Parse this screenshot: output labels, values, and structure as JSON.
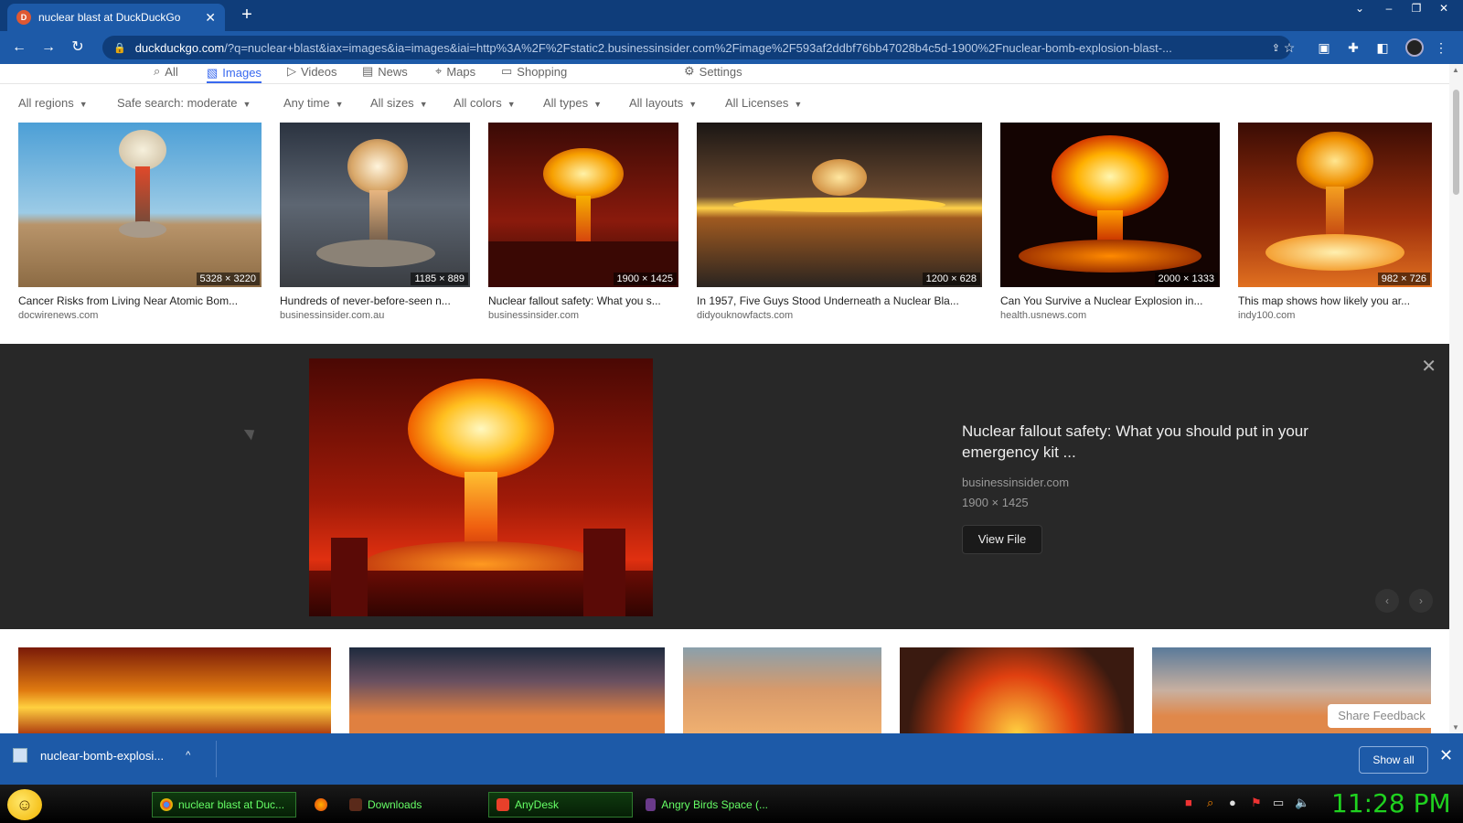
{
  "browser": {
    "tab_title": "nuclear blast at DuckDuckGo",
    "url_host": "duckduckgo.com",
    "url_rest": "/?q=nuclear+blast&iax=images&ia=images&iai=http%3A%2F%2Fstatic2.businessinsider.com%2Fimage%2F593af2ddbf76bb47028b4c5d-1900%2Fnuclear-bomb-explosion-blast-..."
  },
  "nav": {
    "items": [
      {
        "label": "All",
        "icon": "search-icon"
      },
      {
        "label": "Images",
        "icon": "image-icon"
      },
      {
        "label": "Videos",
        "icon": "play-icon"
      },
      {
        "label": "News",
        "icon": "news-icon"
      },
      {
        "label": "Maps",
        "icon": "map-pin-icon"
      },
      {
        "label": "Shopping",
        "icon": "shopping-bag-icon"
      }
    ],
    "settings": "Settings"
  },
  "filters": [
    "All regions",
    "Safe search: moderate",
    "Any time",
    "All sizes",
    "All colors",
    "All types",
    "All layouts",
    "All Licenses"
  ],
  "results": [
    {
      "title": "Cancer Risks from Living Near Atomic Bom...",
      "source": "docwirenews.com",
      "dims": "5328 × 3220",
      "palette": "desert"
    },
    {
      "title": "Hundreds of never-before-seen n...",
      "source": "businessinsider.com.au",
      "dims": "1185 × 889",
      "palette": "grey"
    },
    {
      "title": "Nuclear fallout safety: What you s...",
      "source": "businessinsider.com",
      "dims": "1900 × 1425",
      "palette": "red"
    },
    {
      "title": "In 1957, Five Guys Stood Underneath a Nuclear Bla...",
      "source": "didyouknowfacts.com",
      "dims": "1200 × 628",
      "palette": "horizon"
    },
    {
      "title": "Can You Survive a Nuclear Explosion in...",
      "source": "health.usnews.com",
      "dims": "2000 × 1333",
      "palette": "fire"
    },
    {
      "title": "This map shows how likely you ar...",
      "source": "indy100.com",
      "dims": "982 × 726",
      "palette": "orange"
    }
  ],
  "detail": {
    "title": "Nuclear fallout safety: What you should put in your emergency kit ...",
    "source": "businessinsider.com",
    "dims": "1900 × 1425",
    "view_button": "View File"
  },
  "share_feedback": "Share Feedback",
  "downloads": {
    "file_name": "nuclear-bomb-explosi...",
    "show_all": "Show all"
  },
  "taskbar": {
    "tasks": [
      "nuclear blast at Duc...",
      "Downloads",
      "AnyDesk",
      "Angry Birds Space (..."
    ],
    "clock": "11:28 PM"
  },
  "colors": {
    "chrome_dark": "#0f3d7a",
    "chrome_blue": "#1d5aa8",
    "accent": "#3969ef",
    "detail_bg": "#282828",
    "clock_green": "#1fd11f"
  }
}
